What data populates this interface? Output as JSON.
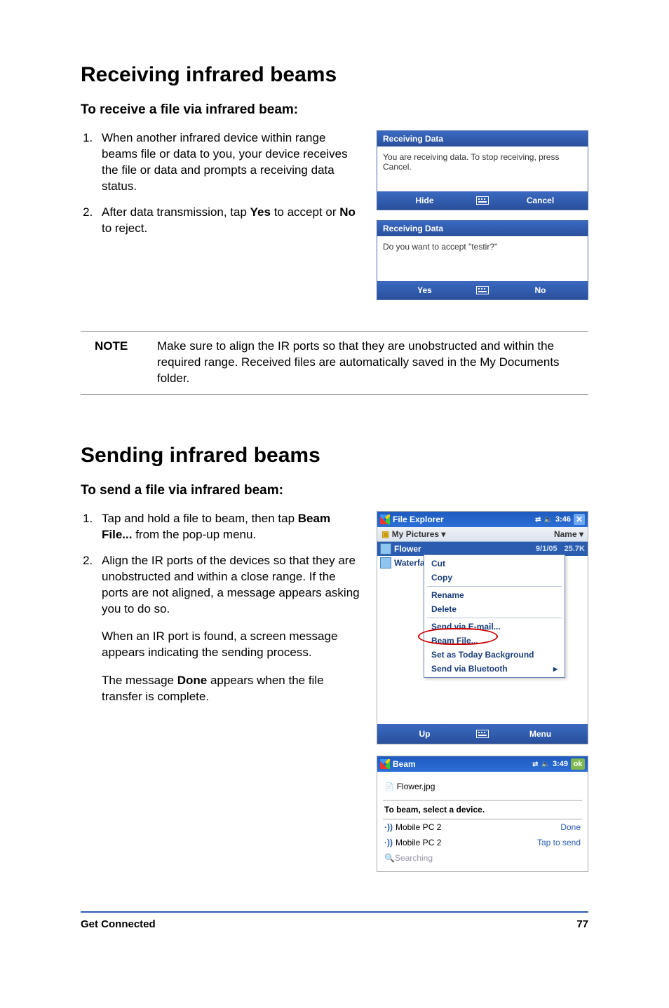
{
  "section1": {
    "heading": "Receiving infrared beams",
    "subheading": "To receive a file via infrared beam:",
    "step1": "When another infrared device within range beams file or data to you, your device receives the file or data and prompts a receiving data status.",
    "step2_pre": "After data transmission, tap ",
    "step2_yes": "Yes",
    "step2_mid": " to accept or ",
    "step2_no": "No",
    "step2_post": " to reject."
  },
  "dialog1": {
    "title": "Receiving Data",
    "body": "You are receiving data. To stop receiving, press Cancel.",
    "btn_left": "Hide",
    "btn_right": "Cancel"
  },
  "dialog2": {
    "title": "Receiving Data",
    "body": "Do you want to accept \"testir?\"",
    "btn_left": "Yes",
    "btn_right": "No"
  },
  "note": {
    "label": "NOTE",
    "text": "Make sure to align the IR ports so that they are unobstructed and within the required range. Received files are automatically saved in the My Documents folder."
  },
  "section2": {
    "heading": "Sending infrared beams",
    "subheading": "To send a file via infrared beam:",
    "step1_pre": "Tap and hold a file to beam, then tap ",
    "step1_bold": "Beam File...",
    "step1_post": " from the pop-up menu.",
    "step2": "Align the IR ports of the devices so that they are unobstructed and within a close range. If the ports are not aligned, a message appears asking you to do so.",
    "para1": "When an IR port is found, a screen message appears indicating the sending process.",
    "para2_pre": "The message ",
    "para2_bold": "Done",
    "para2_post": " appears when the file transfer is complete."
  },
  "fe_screen": {
    "title": "File Explorer",
    "time": "3:46",
    "close": "✕",
    "folder": "My Pictures",
    "sort": "Name",
    "files": {
      "flower": {
        "name": "Flower",
        "date": "9/1/05",
        "size": "25.7K"
      },
      "waterfall": "Waterfa"
    },
    "menu": {
      "cut": "Cut",
      "copy": "Copy",
      "rename": "Rename",
      "delete": "Delete",
      "sendemail": "Send via E-mail...",
      "beamfile": "Beam File...",
      "setbg": "Set as Today Background",
      "sendbt": "Send via Bluetooth",
      "arrow": "▸"
    },
    "btn_left": "Up",
    "btn_right": "Menu"
  },
  "beam_screen": {
    "title": "Beam",
    "time": "3:49",
    "ok": "ok",
    "file": "Flower.jpg",
    "instruction": "To beam, select a device.",
    "devices": [
      {
        "name": "Mobile PC 2",
        "status": "Done"
      },
      {
        "name": "Mobile PC 2",
        "status": "Tap to send"
      }
    ],
    "searching": "Searching"
  },
  "footer": {
    "section": "Get Connected",
    "page": "77"
  }
}
